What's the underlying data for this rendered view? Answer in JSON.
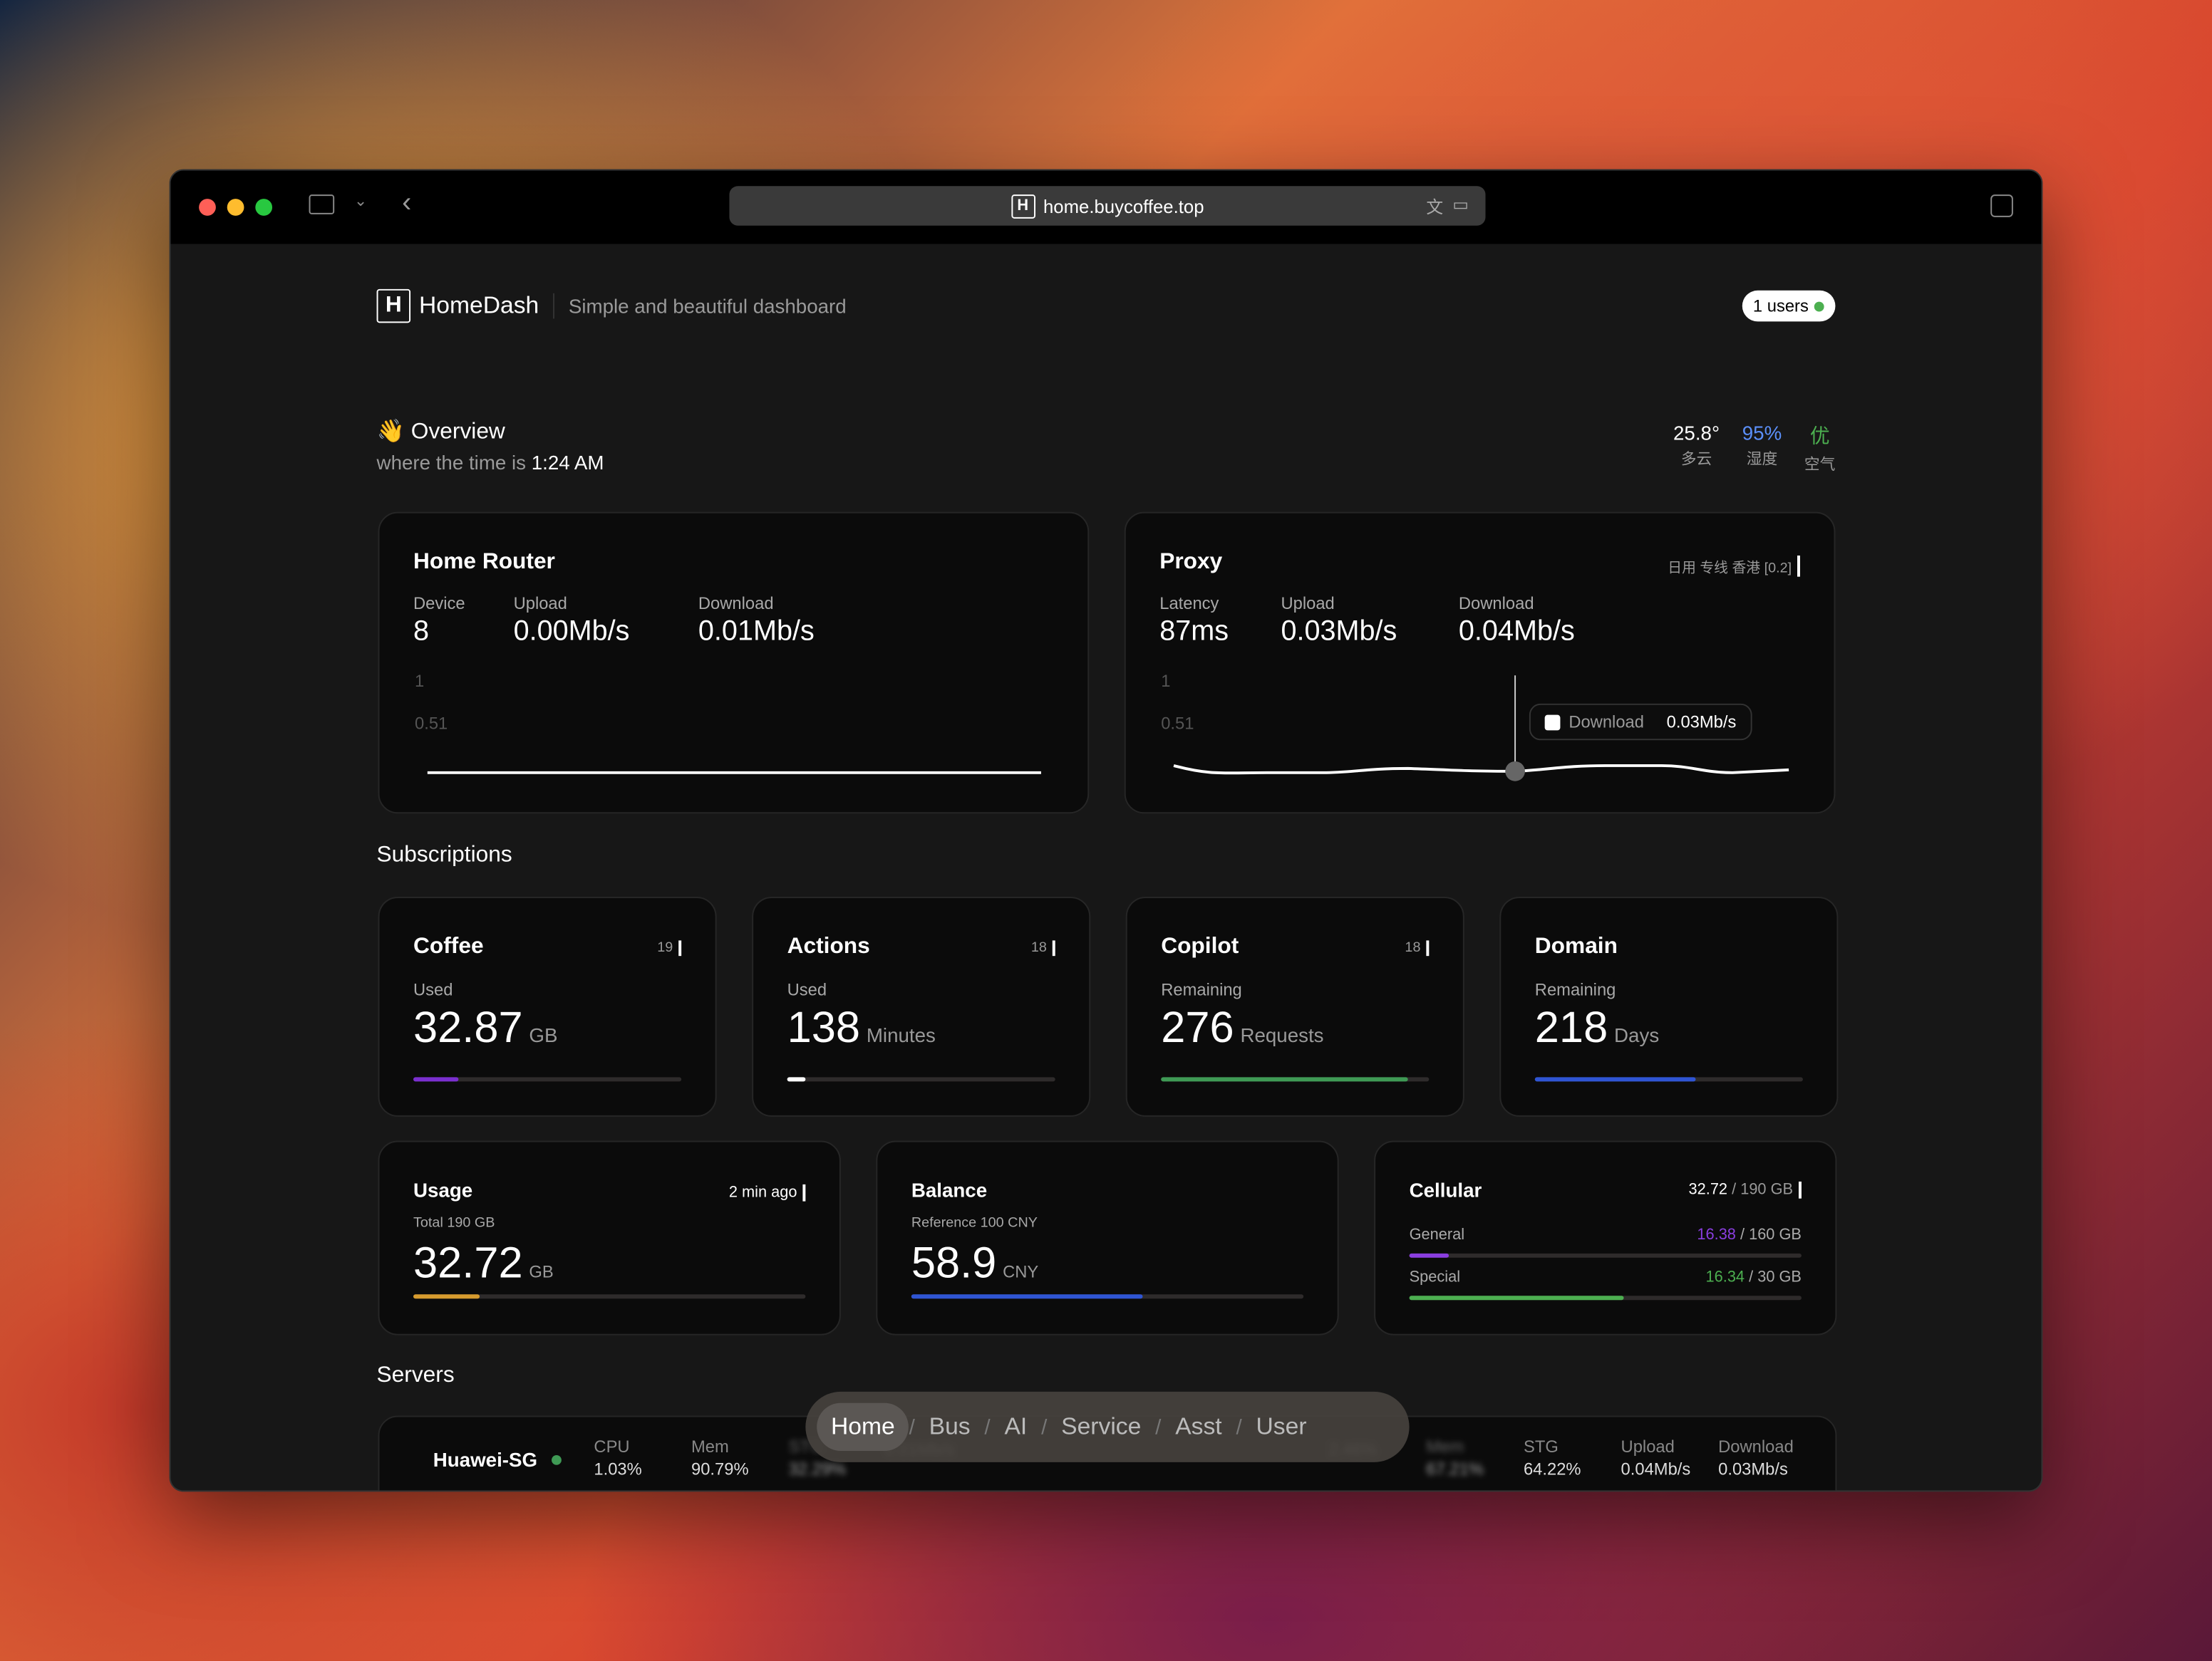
{
  "browser": {
    "url": "home.buycoffee.top"
  },
  "header": {
    "logo": "H",
    "app_name": "HomeDash",
    "tagline": "Simple and beautiful dashboard",
    "users_badge": "1 users"
  },
  "overview": {
    "title": "Overview",
    "time_prefix": "where the time is",
    "time": "1:24 AM",
    "weather": [
      {
        "value": "25.8°",
        "label": "多云",
        "color": "#ffffff"
      },
      {
        "value": "95%",
        "label": "湿度",
        "color": "#5b8ff9"
      },
      {
        "value": "优",
        "label": "空气",
        "color": "#4caf50"
      }
    ]
  },
  "router": {
    "title": "Home Router",
    "stats": [
      {
        "label": "Device",
        "value": "8"
      },
      {
        "label": "Upload",
        "value": "0.00Mb/s"
      },
      {
        "label": "Download",
        "value": "0.01Mb/s"
      }
    ],
    "y_ticks": [
      "1",
      "0.51"
    ]
  },
  "proxy": {
    "title": "Proxy",
    "badge": "日用 专线 香港 [0.2]",
    "stats": [
      {
        "label": "Latency",
        "value": "87ms"
      },
      {
        "label": "Upload",
        "value": "0.03Mb/s"
      },
      {
        "label": "Download",
        "value": "0.04Mb/s"
      }
    ],
    "y_ticks": [
      "1",
      "0.51"
    ],
    "tooltip": {
      "series": "Download",
      "value": "0.03Mb/s"
    }
  },
  "subscriptions": {
    "title": "Subscriptions",
    "items": [
      {
        "name": "Coffee",
        "badge": "19",
        "label": "Used",
        "value": "32.87",
        "unit": "GB",
        "progress": 0.17,
        "color": "#7b2fd0"
      },
      {
        "name": "Actions",
        "badge": "18",
        "label": "Used",
        "value": "138",
        "unit": "Minutes",
        "progress": 0.07,
        "color": "#ffffff"
      },
      {
        "name": "Copilot",
        "badge": "18",
        "label": "Remaining",
        "value": "276",
        "unit": "Requests",
        "progress": 0.92,
        "color": "#3f9a55"
      },
      {
        "name": "Domain",
        "badge": "",
        "label": "Remaining",
        "value": "218",
        "unit": "Days",
        "progress": 0.6,
        "color": "#2f55d4"
      }
    ]
  },
  "usage": {
    "title": "Usage",
    "badge": "2 min ago",
    "label": "Total 190 GB",
    "value": "32.72",
    "unit": "GB",
    "progress": 0.17,
    "color": "#d69b2e"
  },
  "balance": {
    "title": "Balance",
    "label": "Reference 100 CNY",
    "value": "58.9",
    "unit": "CNY",
    "progress": 0.59,
    "color": "#2f55d4"
  },
  "cellular": {
    "title": "Cellular",
    "used": "32.72",
    "total": "/ 190  GB",
    "rows": [
      {
        "label": "General",
        "used": "16.38",
        "total": "/ 160  GB",
        "progress": 0.1,
        "color": "#8a3ee0"
      },
      {
        "label": "Special",
        "used": "16.34",
        "total": "/ 30  GB",
        "progress": 0.545,
        "color": "#4caf50"
      }
    ]
  },
  "servers": {
    "title": "Servers",
    "name": "Huawei-SG",
    "cols": [
      {
        "label": "CPU",
        "value": "1.03%"
      },
      {
        "label": "Mem",
        "value": "90.79%"
      },
      {
        "label": "STG",
        "value": "32.29%"
      },
      {
        "label": "",
        "value": "0.01Mb/s"
      },
      {
        "label": "",
        "value": "2.46%"
      },
      {
        "label": "Mem",
        "value": "67.21%"
      },
      {
        "label": "STG",
        "value": "64.22%"
      },
      {
        "label": "Upload",
        "value": "0.04Mb/s"
      },
      {
        "label": "Download",
        "value": "0.03Mb/s"
      }
    ]
  },
  "nav": {
    "items": [
      "Home",
      "Bus",
      "AI",
      "Service",
      "Asst",
      "User"
    ]
  }
}
